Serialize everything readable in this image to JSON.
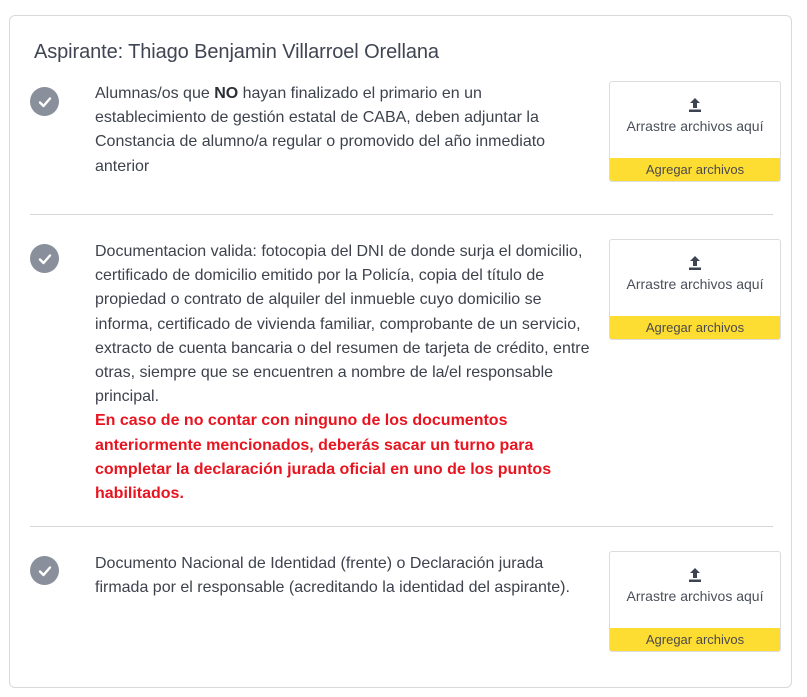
{
  "title": {
    "prefix": "Aspirante: ",
    "name": "Thiago Benjamin Villarroel Orellana"
  },
  "requirements": [
    {
      "text_before": "Alumnas/os que ",
      "text_bold": "NO",
      "text_after": " hayan finalizado el primario en un establecimiento de gestión estatal de CABA, deben adjuntar la Constancia de alumno/a regular o promovido del año inmediato anterior",
      "status": "complete"
    },
    {
      "text": "Documentacion valida: fotocopia del DNI de donde surja el domicilio, certificado de domicilio emitido por la Policía, copia del título de propiedad o contrato de alquiler del inmueble cuyo domicilio se informa, certificado de vivienda familiar, comprobante de un servicio, extracto de cuenta bancaria o del resumen de tarjeta de crédito, entre otras, siempre que se encuentren a nombre de la/el responsable principal.",
      "warning": "En caso de no contar con ninguno de los documentos anteriormente mencionados, deberás sacar un turno para completar la declaración jurada oficial en uno de los puntos habilitados.",
      "status": "complete"
    },
    {
      "text": "Documento Nacional de Identidad (frente) o Declaración jurada firmada por el responsable (acreditando la identidad del aspirante).",
      "status": "complete"
    }
  ],
  "upload": {
    "drop_label": "Arrastre archivos aquí",
    "add_label": "Agregar archivos",
    "icon": "upload-icon"
  },
  "colors": {
    "check_bg": "#8a8f9c",
    "add_button_bg": "#fedd33",
    "warning_text": "#e8141f"
  }
}
